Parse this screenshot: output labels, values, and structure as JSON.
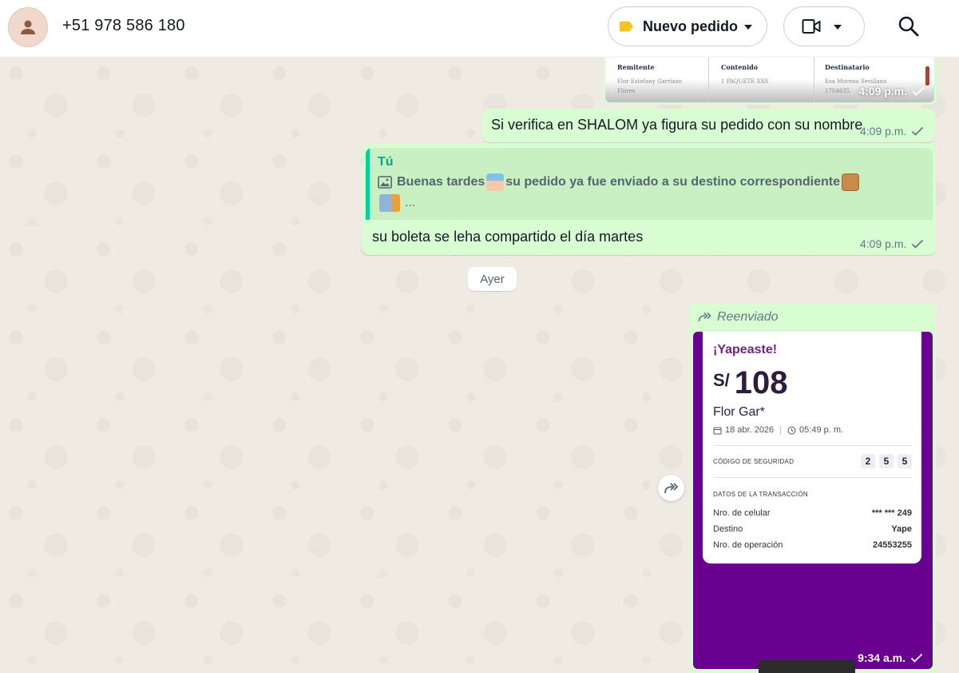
{
  "header": {
    "contact_name": "+51 978 586 180",
    "label_button": "Nuevo pedido",
    "label_color": "#f2c526",
    "icons": [
      "user-avatar-icon",
      "label-tag-icon",
      "video-camera-icon",
      "search-icon"
    ]
  },
  "messages": {
    "shipping_ticket": {
      "columns": [
        {
          "header": "Remitente",
          "lines": [
            "Flor Estefany Garriazo",
            "Flores"
          ]
        },
        {
          "header": "Contenido",
          "lines": [
            "1 PAQUETE XXS"
          ]
        },
        {
          "header": "Destinatario",
          "lines": [
            "Esa Moreno Sevillano",
            "1764635"
          ]
        }
      ],
      "time": "4:09 p.m."
    },
    "verify": {
      "text": "Si verifica en SHALOM ya figura su pedido con su nombre",
      "time": "4:09 p.m."
    },
    "quoted": {
      "author": "Tú",
      "text": "Buenas tardes",
      "text_after": "su pedido ya fue enviado a su destino correspondiente",
      "ellipsis": "..."
    },
    "reply": {
      "text": "su boleta se leha compartido el día martes",
      "time": "4:09 p.m."
    },
    "date_divider": "Ayer",
    "forwarded": {
      "label": "Reenviado",
      "time": "9:34 a.m."
    }
  },
  "yape": {
    "title": "¡Yapeaste!",
    "currency": "S/",
    "amount": "108",
    "name": "Flor Gar*",
    "date": "18 abr. 2026",
    "time": "05:49 p. m.",
    "security_label": "CÓDIGO DE SEGURIDAD",
    "security_code": [
      "2",
      "5",
      "5"
    ],
    "details_label": "DATOS DE LA TRANSACCIÓN",
    "rows": [
      {
        "label": "Nro. de celular",
        "value": "*** *** 249"
      },
      {
        "label": "Destino",
        "value": "Yape"
      },
      {
        "label": "Nro. de operación",
        "value": "24553255"
      }
    ],
    "accent_color": "#742284",
    "background_color": "#6a008f"
  },
  "colors": {
    "outgoing_bubble": "#d9fdd3",
    "chat_background": "#efeae2",
    "quote_accent": "#06cf9c"
  }
}
